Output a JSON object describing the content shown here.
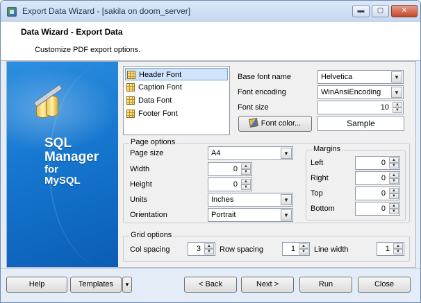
{
  "window": {
    "title": "Export Data Wizard - [sakila on doom_server]",
    "buttons": {
      "minimize": "▬",
      "maximize": "▢",
      "close": "✕"
    }
  },
  "header": {
    "title": "Data Wizard - Export Data",
    "subtitle": "Customize PDF export options."
  },
  "banner": {
    "line1": "SQL",
    "line2": "Manager",
    "line3": "for",
    "line4": "MySQL"
  },
  "font_list": {
    "items": [
      {
        "label": "Header Font",
        "selected": true
      },
      {
        "label": "Caption Font",
        "selected": false
      },
      {
        "label": "Data Font",
        "selected": false
      },
      {
        "label": "Footer Font",
        "selected": false
      }
    ]
  },
  "font_settings": {
    "base_font_label": "Base font name",
    "base_font_value": "Helvetica",
    "encoding_label": "Font encoding",
    "encoding_value": "WinAnsiEncoding",
    "size_label": "Font size",
    "size_value": "10",
    "color_button": "Font color...",
    "sample_text": "Sample"
  },
  "page_options": {
    "title": "Page options",
    "page_size_label": "Page size",
    "page_size_value": "A4",
    "width_label": "Width",
    "width_value": "0",
    "height_label": "Height",
    "height_value": "0",
    "units_label": "Units",
    "units_value": "Inches",
    "orientation_label": "Orientation",
    "orientation_value": "Portrait"
  },
  "margins": {
    "title": "Margins",
    "left_label": "Left",
    "left_value": "0",
    "right_label": "Right",
    "right_value": "0",
    "top_label": "Top",
    "top_value": "0",
    "bottom_label": "Bottom",
    "bottom_value": "0"
  },
  "grid_options": {
    "title": "Grid options",
    "col_spacing_label": "Col spacing",
    "col_spacing_value": "3",
    "row_spacing_label": "Row spacing",
    "row_spacing_value": "1",
    "line_width_label": "Line width",
    "line_width_value": "1"
  },
  "footer": {
    "help": "Help",
    "templates": "Templates",
    "back": "< Back",
    "next": "Next >",
    "run": "Run",
    "close": "Close"
  },
  "colors": {
    "banner": "#1677cf",
    "selection": "#cfe3fb",
    "window_frame": "#e4ecf7"
  }
}
